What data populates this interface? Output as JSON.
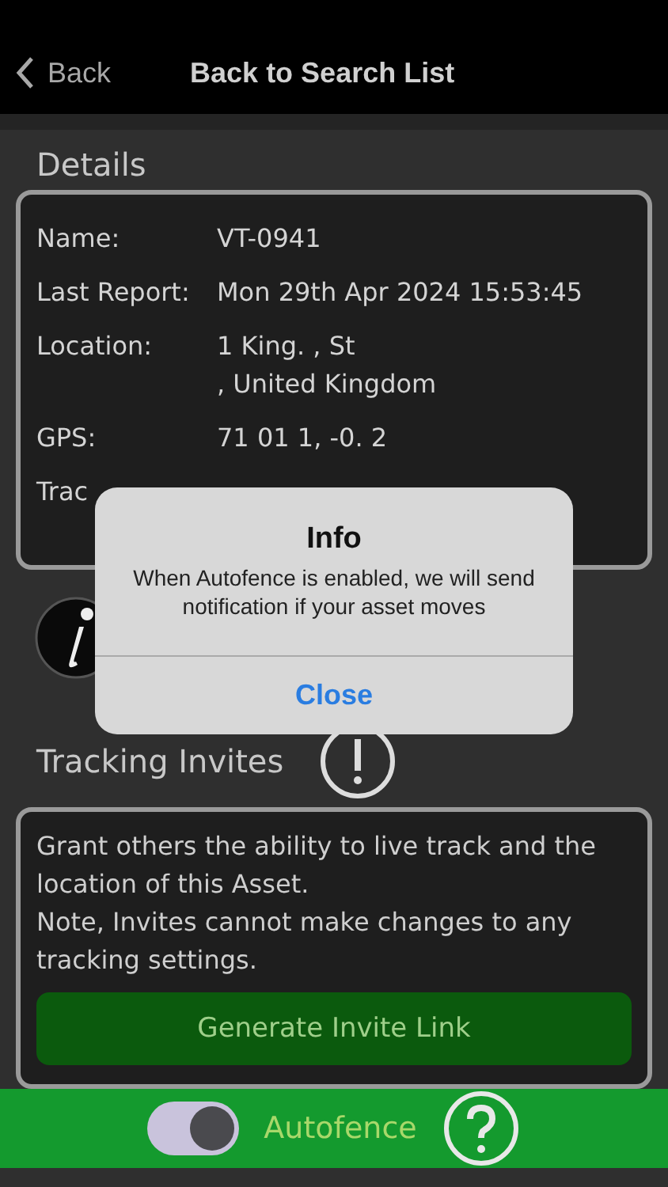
{
  "nav": {
    "back": "Back",
    "title": "Back to Search List"
  },
  "details": {
    "heading": "Details",
    "rows": [
      {
        "label": "Name:",
        "value": [
          "VT-0941"
        ]
      },
      {
        "label": "Last Report:",
        "value": [
          "Mon 29th Apr 2024 15:53:45"
        ]
      },
      {
        "label": "Location:",
        "value": [
          "1   King.                 , St",
          ", United Kingdom"
        ]
      },
      {
        "label": "GPS:",
        "value": [
          "71 01 1, -0.  2"
        ]
      },
      {
        "label": "Trac",
        "value": []
      }
    ]
  },
  "invites": {
    "heading": "Tracking Invites",
    "text": [
      "Grant others the ability to live track and  the location of this Asset.",
      "Note, Invites cannot make changes to any tracking settings."
    ],
    "button": "Generate Invite Link"
  },
  "autofence": {
    "label": "Autofence",
    "on": true
  },
  "alert": {
    "title": "Info",
    "message": "When Autofence is enabled, we will send notification if your asset moves",
    "button": "Close"
  }
}
